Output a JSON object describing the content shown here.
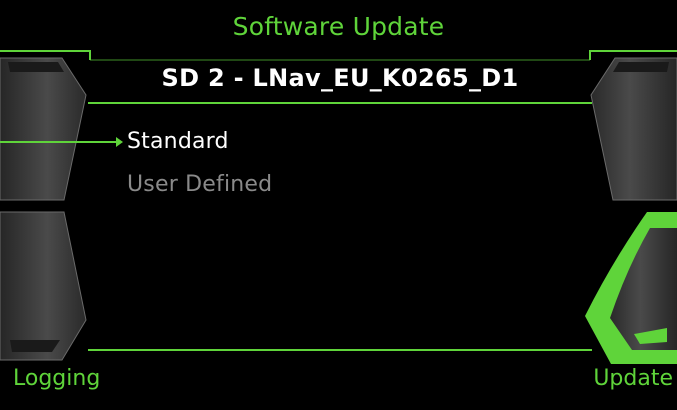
{
  "header": {
    "title": "Software Update",
    "subtitle": "SD 2 - LNav_EU_K0265_D1"
  },
  "menu": {
    "options": [
      {
        "label": "Standard",
        "selected": true
      },
      {
        "label": "User Defined",
        "selected": false
      }
    ]
  },
  "softkeys": {
    "bottom_left": "Logging",
    "bottom_right": "Update",
    "active": "bottom_right"
  },
  "colors": {
    "accent": "#5fd43a",
    "background": "#000000",
    "text_primary": "#ffffff",
    "text_secondary": "#8a8a8a",
    "bezel_gray": "#444444"
  },
  "icons": {
    "selection_indicator": "triangle-left-icon"
  }
}
